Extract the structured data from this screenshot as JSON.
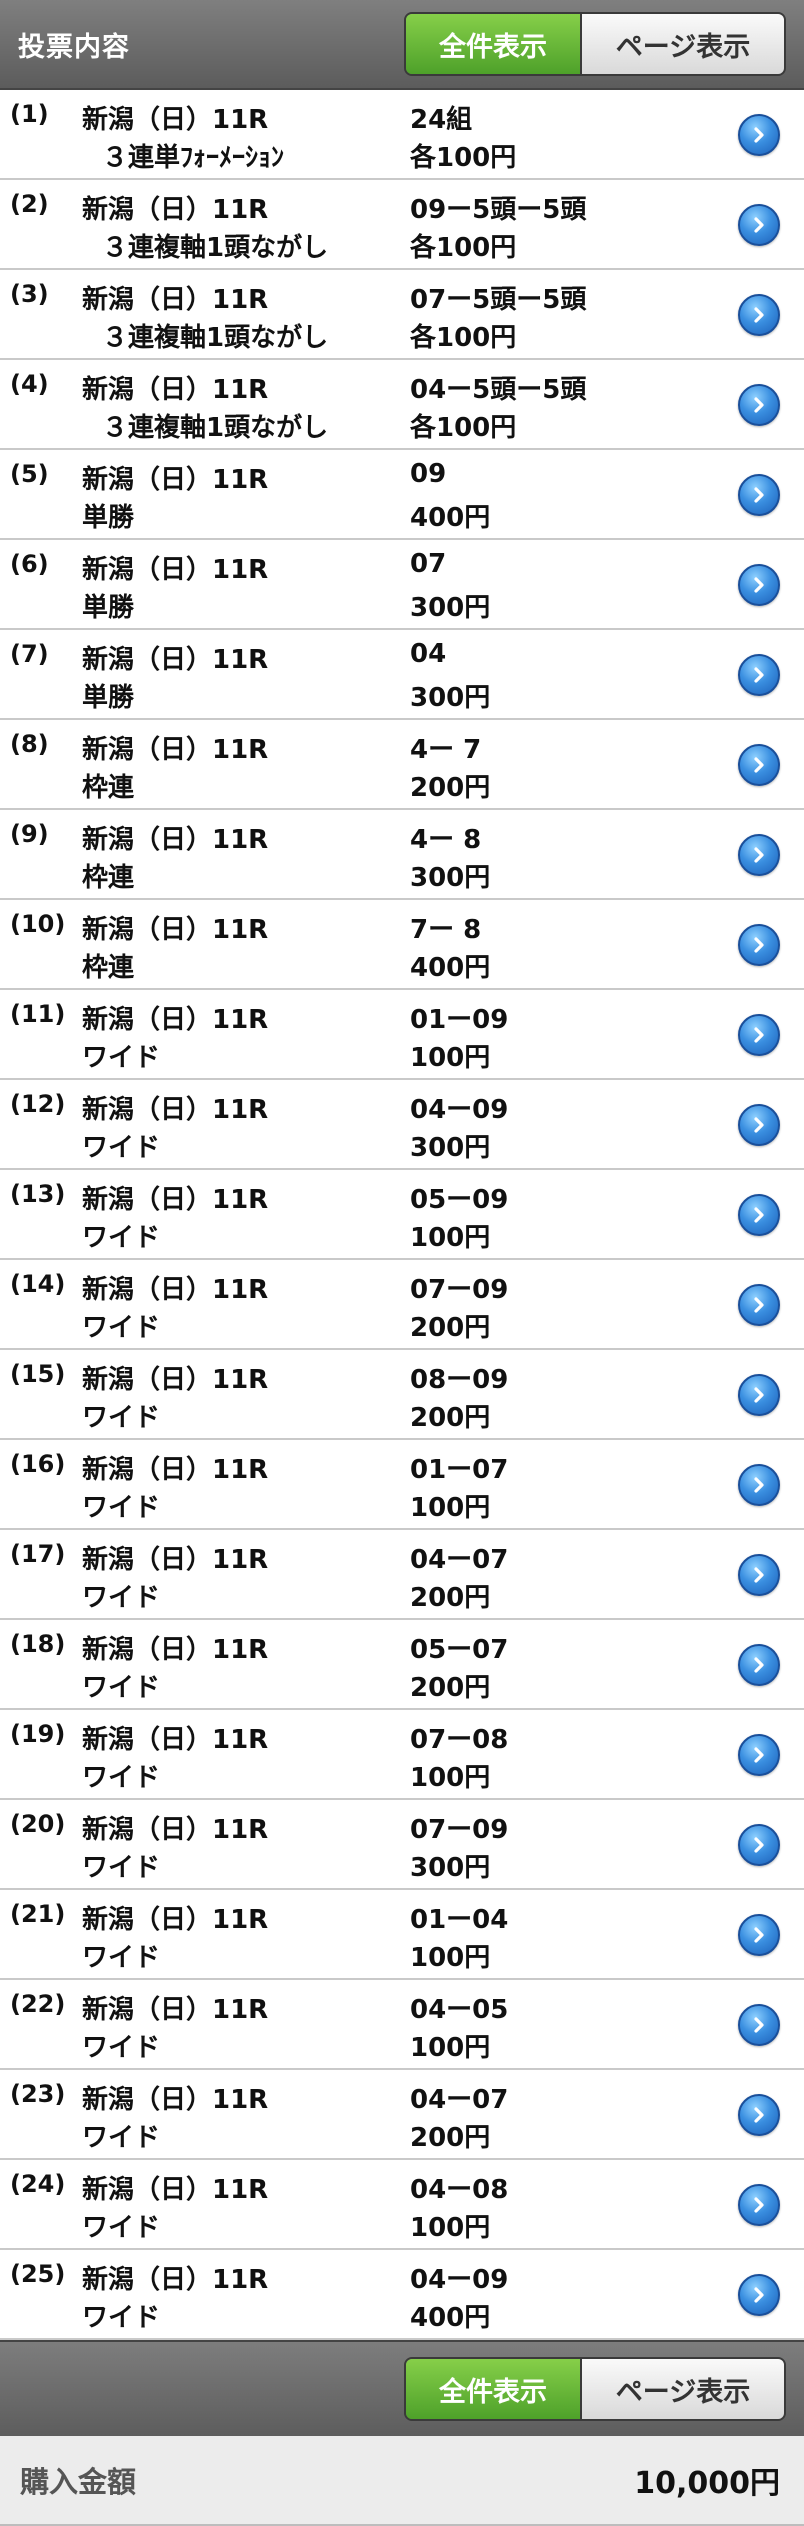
{
  "header": {
    "title": "投票内容",
    "all_view": "全件表示",
    "page_view": "ページ表示"
  },
  "bets": [
    {
      "num": "(1)",
      "race": "新潟（日）11R",
      "type": "３連単ﾌｫｰﾒｰｼｮﾝ",
      "combo": "24組",
      "amount": "各100円",
      "indent": true
    },
    {
      "num": "(2)",
      "race": "新潟（日）11R",
      "type": "３連複軸1頭ながし",
      "combo": "09ー5頭ー5頭",
      "amount": "各100円",
      "indent": true
    },
    {
      "num": "(3)",
      "race": "新潟（日）11R",
      "type": "３連複軸1頭ながし",
      "combo": "07ー5頭ー5頭",
      "amount": "各100円",
      "indent": true
    },
    {
      "num": "(4)",
      "race": "新潟（日）11R",
      "type": "３連複軸1頭ながし",
      "combo": "04ー5頭ー5頭",
      "amount": "各100円",
      "indent": true
    },
    {
      "num": "(5)",
      "race": "新潟（日）11R",
      "type": "単勝",
      "combo": "09",
      "amount": "400円",
      "indent": false
    },
    {
      "num": "(6)",
      "race": "新潟（日）11R",
      "type": "単勝",
      "combo": "07",
      "amount": "300円",
      "indent": false
    },
    {
      "num": "(7)",
      "race": "新潟（日）11R",
      "type": "単勝",
      "combo": "04",
      "amount": "300円",
      "indent": false
    },
    {
      "num": "(8)",
      "race": "新潟（日）11R",
      "type": "枠連",
      "combo": "4ー 7",
      "amount": "200円",
      "indent": false
    },
    {
      "num": "(9)",
      "race": "新潟（日）11R",
      "type": "枠連",
      "combo": "4ー 8",
      "amount": "300円",
      "indent": false
    },
    {
      "num": "(10)",
      "race": "新潟（日）11R",
      "type": "枠連",
      "combo": "7ー 8",
      "amount": "400円",
      "indent": false
    },
    {
      "num": "(11)",
      "race": "新潟（日）11R",
      "type": "ワイド",
      "combo": "01ー09",
      "amount": "100円",
      "indent": false
    },
    {
      "num": "(12)",
      "race": "新潟（日）11R",
      "type": "ワイド",
      "combo": "04ー09",
      "amount": "300円",
      "indent": false
    },
    {
      "num": "(13)",
      "race": "新潟（日）11R",
      "type": "ワイド",
      "combo": "05ー09",
      "amount": "100円",
      "indent": false
    },
    {
      "num": "(14)",
      "race": "新潟（日）11R",
      "type": "ワイド",
      "combo": "07ー09",
      "amount": "200円",
      "indent": false
    },
    {
      "num": "(15)",
      "race": "新潟（日）11R",
      "type": "ワイド",
      "combo": "08ー09",
      "amount": "200円",
      "indent": false
    },
    {
      "num": "(16)",
      "race": "新潟（日）11R",
      "type": "ワイド",
      "combo": "01ー07",
      "amount": "100円",
      "indent": false
    },
    {
      "num": "(17)",
      "race": "新潟（日）11R",
      "type": "ワイド",
      "combo": "04ー07",
      "amount": "200円",
      "indent": false
    },
    {
      "num": "(18)",
      "race": "新潟（日）11R",
      "type": "ワイド",
      "combo": "05ー07",
      "amount": "200円",
      "indent": false
    },
    {
      "num": "(19)",
      "race": "新潟（日）11R",
      "type": "ワイド",
      "combo": "07ー08",
      "amount": "100円",
      "indent": false
    },
    {
      "num": "(20)",
      "race": "新潟（日）11R",
      "type": "ワイド",
      "combo": "07ー09",
      "amount": "300円",
      "indent": false
    },
    {
      "num": "(21)",
      "race": "新潟（日）11R",
      "type": "ワイド",
      "combo": "01ー04",
      "amount": "100円",
      "indent": false
    },
    {
      "num": "(22)",
      "race": "新潟（日）11R",
      "type": "ワイド",
      "combo": "04ー05",
      "amount": "100円",
      "indent": false
    },
    {
      "num": "(23)",
      "race": "新潟（日）11R",
      "type": "ワイド",
      "combo": "04ー07",
      "amount": "200円",
      "indent": false
    },
    {
      "num": "(24)",
      "race": "新潟（日）11R",
      "type": "ワイド",
      "combo": "04ー08",
      "amount": "100円",
      "indent": false
    },
    {
      "num": "(25)",
      "race": "新潟（日）11R",
      "type": "ワイド",
      "combo": "04ー09",
      "amount": "400円",
      "indent": false
    }
  ],
  "footer": {
    "all_view": "全件表示",
    "page_view": "ページ表示"
  },
  "total": {
    "label": "購入金額",
    "value": "10,000円"
  },
  "colors": {
    "active_toggle": "#5cb535",
    "detail_button": "#2f7fd6"
  }
}
